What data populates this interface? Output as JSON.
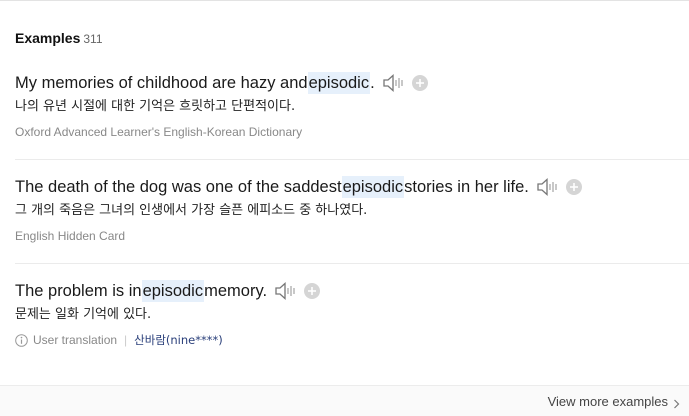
{
  "header": {
    "title": "Examples",
    "count": "311"
  },
  "examples": [
    {
      "en_before": "My memories of childhood are hazy and ",
      "en_highlight": "episodic",
      "en_after": ".",
      "ko": "나의 유년 시절에 대한 기억은 흐릿하고 단편적이다.",
      "source": "Oxford Advanced Learner's English-Korean Dictionary"
    },
    {
      "en_before": "The death of the dog was one of the saddest ",
      "en_highlight": "episodic",
      "en_after": " stories in her life.",
      "ko": "그 개의 죽음은 그녀의 인생에서 가장 슬픈 에피소드 중 하나였다.",
      "source": "English Hidden Card"
    },
    {
      "en_before": "The problem is in ",
      "en_highlight": "episodic",
      "en_after": " memory.",
      "ko": "문제는 일화 기억에 있다.",
      "source": "User translation",
      "user": "산바람(nine****)"
    }
  ],
  "footer": {
    "more_label": "View more examples"
  },
  "icons": {
    "speaker": "speaker-icon",
    "add": "plus-circle-icon",
    "info": "info-icon",
    "chevron": "chevron-right-icon"
  },
  "colors": {
    "highlight": "#e6f0fb",
    "source_text": "#888888",
    "user_link": "#2a3f7a"
  }
}
